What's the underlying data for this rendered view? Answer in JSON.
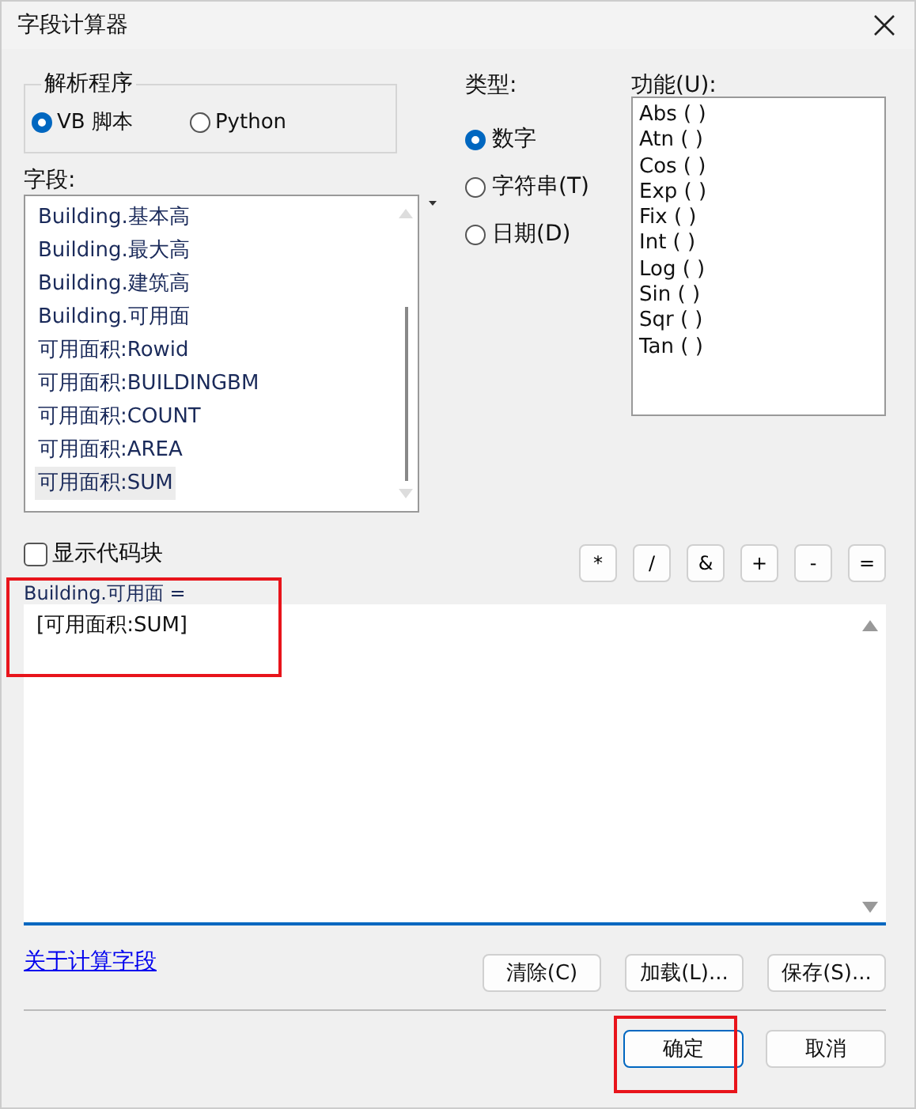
{
  "window": {
    "title": "字段计算器"
  },
  "parser": {
    "label": "解析程序",
    "options": [
      {
        "label": "VB 脚本",
        "selected": true
      },
      {
        "label": "Python",
        "selected": false
      }
    ]
  },
  "fields": {
    "label": "字段:",
    "items": [
      {
        "label": "Building.基本高",
        "selected": false
      },
      {
        "label": "Building.最大高",
        "selected": false
      },
      {
        "label": "Building.建筑高",
        "selected": false
      },
      {
        "label": "Building.可用面",
        "selected": false
      },
      {
        "label": "可用面积:Rowid",
        "selected": false
      },
      {
        "label": "可用面积:BUILDINGBM",
        "selected": false
      },
      {
        "label": "可用面积:COUNT",
        "selected": false
      },
      {
        "label": "可用面积:AREA",
        "selected": false
      },
      {
        "label": "可用面积:SUM",
        "selected": true
      }
    ]
  },
  "type": {
    "label": "类型:",
    "options": [
      {
        "label": "数字",
        "selected": true
      },
      {
        "label": "字符串(T)",
        "selected": false
      },
      {
        "label": "日期(D)",
        "selected": false
      }
    ]
  },
  "functions": {
    "label": "功能(U):",
    "items": [
      "Abs ( )",
      "Atn ( )",
      "Cos ( )",
      "Exp ( )",
      "Fix ( )",
      "Int ( )",
      "Log ( )",
      "Sin ( )",
      "Sqr ( )",
      "Tan ( )"
    ]
  },
  "show_codeblock": {
    "label": "显示代码块",
    "checked": false
  },
  "operators": [
    "*",
    "/",
    "&",
    "+",
    "-",
    "="
  ],
  "expression": {
    "label": "Building.可用面 =",
    "value": "[可用面积:SUM]",
    "highlighted": true
  },
  "about_link": "关于计算字段",
  "actions": [
    "清除(C)",
    "加载(L)...",
    "保存(S)..."
  ],
  "dialog_buttons": [
    {
      "label": "确定",
      "default": true,
      "highlighted": true
    },
    {
      "label": "取消",
      "default": false,
      "highlighted": false
    }
  ]
}
